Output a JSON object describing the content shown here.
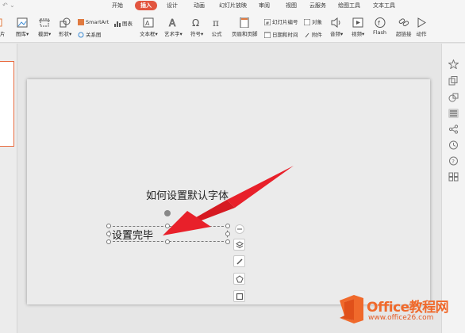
{
  "menu": {
    "tabs": [
      "开始",
      "插入",
      "设计",
      "动画",
      "幻灯片放映",
      "审阅",
      "视图",
      "云服务",
      "绘图工具",
      "文本工具"
    ],
    "active": "插入"
  },
  "ribbon": {
    "partial_left": "灯片",
    "picture": "图片",
    "library": "图库",
    "screenshot": "截屏",
    "shape": "形状",
    "smartart": "SmartArt",
    "chart": "图表",
    "relation": "关系图",
    "textbox": "文本框",
    "wordart": "艺术字",
    "symbol": "符号",
    "formula": "公式",
    "header_footer": "页眉和页脚",
    "slide_number": "幻灯片编号",
    "object": "对象",
    "datetime": "日期和时间",
    "attachment": "附件",
    "audio": "音频",
    "video": "视频",
    "flash": "Flash",
    "hyperlink": "超链接",
    "action": "动作"
  },
  "slide": {
    "title": "如何设置默认字体",
    "textbox": "设置完毕"
  },
  "watermark": {
    "title": "Office教程网",
    "url": "www.office26.com"
  },
  "colors": {
    "accent": "#e2553f",
    "arrow": "#e8202a",
    "watermark": "#f0692b"
  }
}
